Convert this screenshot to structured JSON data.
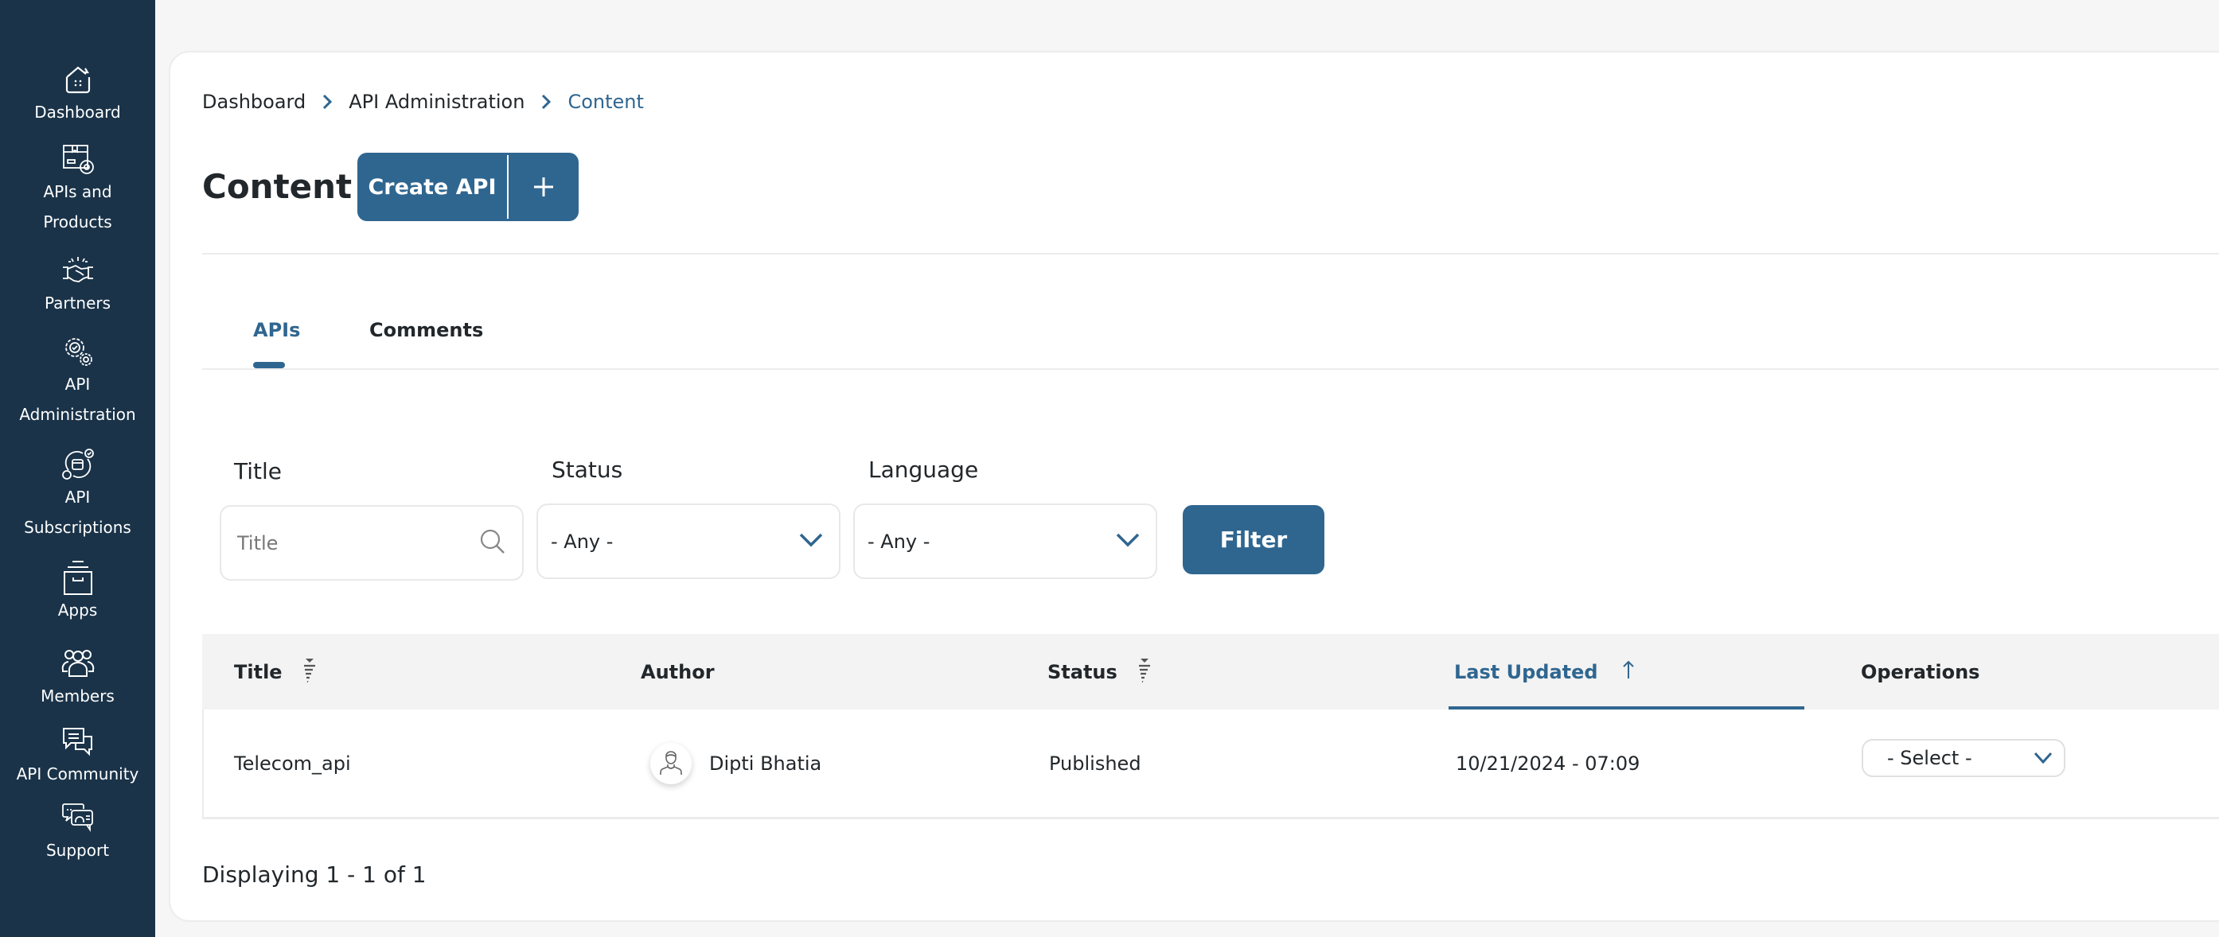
{
  "colors": {
    "sidebar_bg": "#1a3349",
    "accent": "#2f6690",
    "page_bg": "#f6f6f6",
    "text": "#22272b"
  },
  "sidebar": {
    "items": [
      {
        "label": "Dashboard",
        "icon": "dashboard-home-icon"
      },
      {
        "label": "APIs and Products",
        "icon": "apis-products-box-icon"
      },
      {
        "label": "Partners",
        "icon": "handshake-icon"
      },
      {
        "label": "API Administration",
        "icon": "gears-icon"
      },
      {
        "label": "API Subscriptions",
        "icon": "subscription-cycle-icon"
      },
      {
        "label": "Apps",
        "icon": "archive-box-icon"
      },
      {
        "label": "Members",
        "icon": "members-group-icon"
      },
      {
        "label": "API Community",
        "icon": "chat-bubbles-icon"
      },
      {
        "label": "Support",
        "icon": "support-headset-chat-icon"
      }
    ],
    "label_lines": {
      "apis_products": [
        "APIs and",
        "Products"
      ],
      "api_admin": [
        "API",
        "Administration"
      ],
      "api_subs": [
        "API",
        "Subscriptions"
      ]
    }
  },
  "breadcrumb": [
    {
      "label": "Dashboard"
    },
    {
      "label": "API Administration"
    },
    {
      "label": "Content"
    }
  ],
  "header": {
    "title": "Content",
    "create_button_label": "Create API",
    "create_button_icon": "plus-icon"
  },
  "tabs": [
    {
      "label": "APIs",
      "active": true
    },
    {
      "label": "Comments",
      "active": false
    }
  ],
  "filters": {
    "title_label": "Title",
    "title_placeholder": "Title",
    "title_value": "",
    "status_label": "Status",
    "status_value": "- Any -",
    "language_label": "Language",
    "language_value": "- Any -",
    "filter_button": "Filter"
  },
  "table": {
    "columns": [
      {
        "label": "Title",
        "sortable": true
      },
      {
        "label": "Author",
        "sortable": false
      },
      {
        "label": "Status",
        "sortable": true
      },
      {
        "label": "Last Updated",
        "sortable": true,
        "sorted": "ascending"
      },
      {
        "label": "Operations",
        "sortable": false
      }
    ],
    "rows": [
      {
        "title": "Telecom_api",
        "author": "Dipti Bhatia",
        "status": "Published",
        "last_updated": "10/21/2024 - 07:09",
        "operation": "- Select -"
      }
    ]
  },
  "pager": {
    "text": "Displaying 1 - 1 of 1"
  }
}
